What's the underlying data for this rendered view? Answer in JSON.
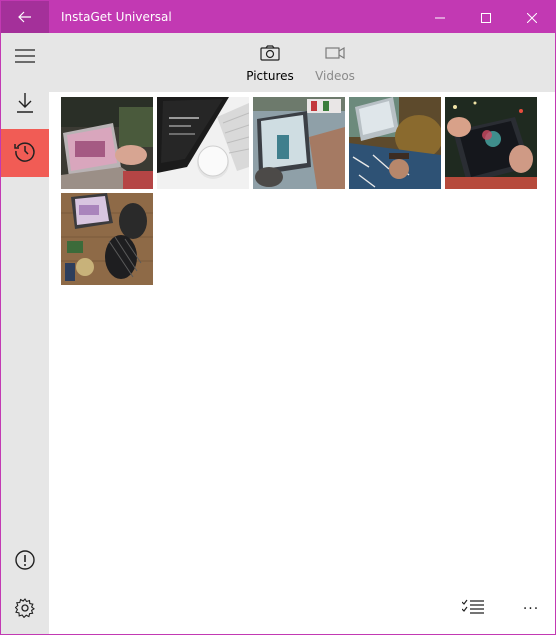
{
  "app": {
    "title": "InstaGet Universal",
    "accent_color": "#c239b3",
    "active_nav_color": "#f15c55"
  },
  "titlebar": {
    "back_icon": "back-arrow-icon",
    "minimize_icon": "minimize-icon",
    "maximize_icon": "maximize-icon",
    "close_icon": "close-icon"
  },
  "sidebar": {
    "items": [
      {
        "icon": "hamburger-menu-icon",
        "active": false
      },
      {
        "icon": "download-icon",
        "active": false
      },
      {
        "icon": "history-icon",
        "active": true
      },
      {
        "icon": "info-icon",
        "active": false
      },
      {
        "icon": "settings-gear-icon",
        "active": false
      }
    ]
  },
  "tabs": [
    {
      "label": "Pictures",
      "icon": "camera-icon",
      "selected": true
    },
    {
      "label": "Videos",
      "icon": "video-camera-icon",
      "selected": false
    }
  ],
  "gallery": {
    "items": [
      {
        "name": "photo-surface-laptop-hands"
      },
      {
        "name": "photo-surface-dial-keyboard"
      },
      {
        "name": "photo-surface-pro-table"
      },
      {
        "name": "photo-person-laptop-couch"
      },
      {
        "name": "photo-tablet-hands-drawing"
      },
      {
        "name": "photo-items-flatlay-wood"
      }
    ]
  },
  "bottom_bar": {
    "select_icon": "multi-select-list-icon",
    "more_icon": "more-ellipsis-icon",
    "more_label": "···"
  }
}
